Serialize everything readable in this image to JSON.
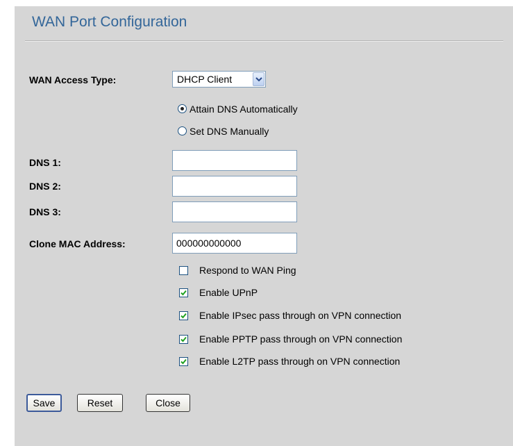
{
  "page": {
    "title": "WAN Port Configuration"
  },
  "wan_access": {
    "label": "WAN Access Type:",
    "selected": "DHCP Client",
    "dns_options": [
      {
        "label": "Attain DNS Automatically",
        "checked": true
      },
      {
        "label": "Set DNS Manually",
        "checked": false
      }
    ]
  },
  "dns": [
    {
      "label": "DNS 1:",
      "value": ""
    },
    {
      "label": "DNS 2:",
      "value": ""
    },
    {
      "label": "DNS 3:",
      "value": ""
    }
  ],
  "clone_mac": {
    "label": "Clone MAC Address:",
    "value": "000000000000"
  },
  "options": [
    {
      "label": "Respond to WAN Ping",
      "checked": false
    },
    {
      "label": "Enable UPnP",
      "checked": true
    },
    {
      "label": "Enable IPsec pass through on VPN connection",
      "checked": true
    },
    {
      "label": "Enable PPTP pass through on VPN connection",
      "checked": true
    },
    {
      "label": "Enable L2TP pass through on VPN connection",
      "checked": true
    }
  ],
  "buttons": {
    "save": "Save",
    "reset": "Reset",
    "close": "Close"
  },
  "colors": {
    "panel_bg": "#d6d6d6",
    "title": "#336699",
    "input_border": "#7f9db9"
  }
}
